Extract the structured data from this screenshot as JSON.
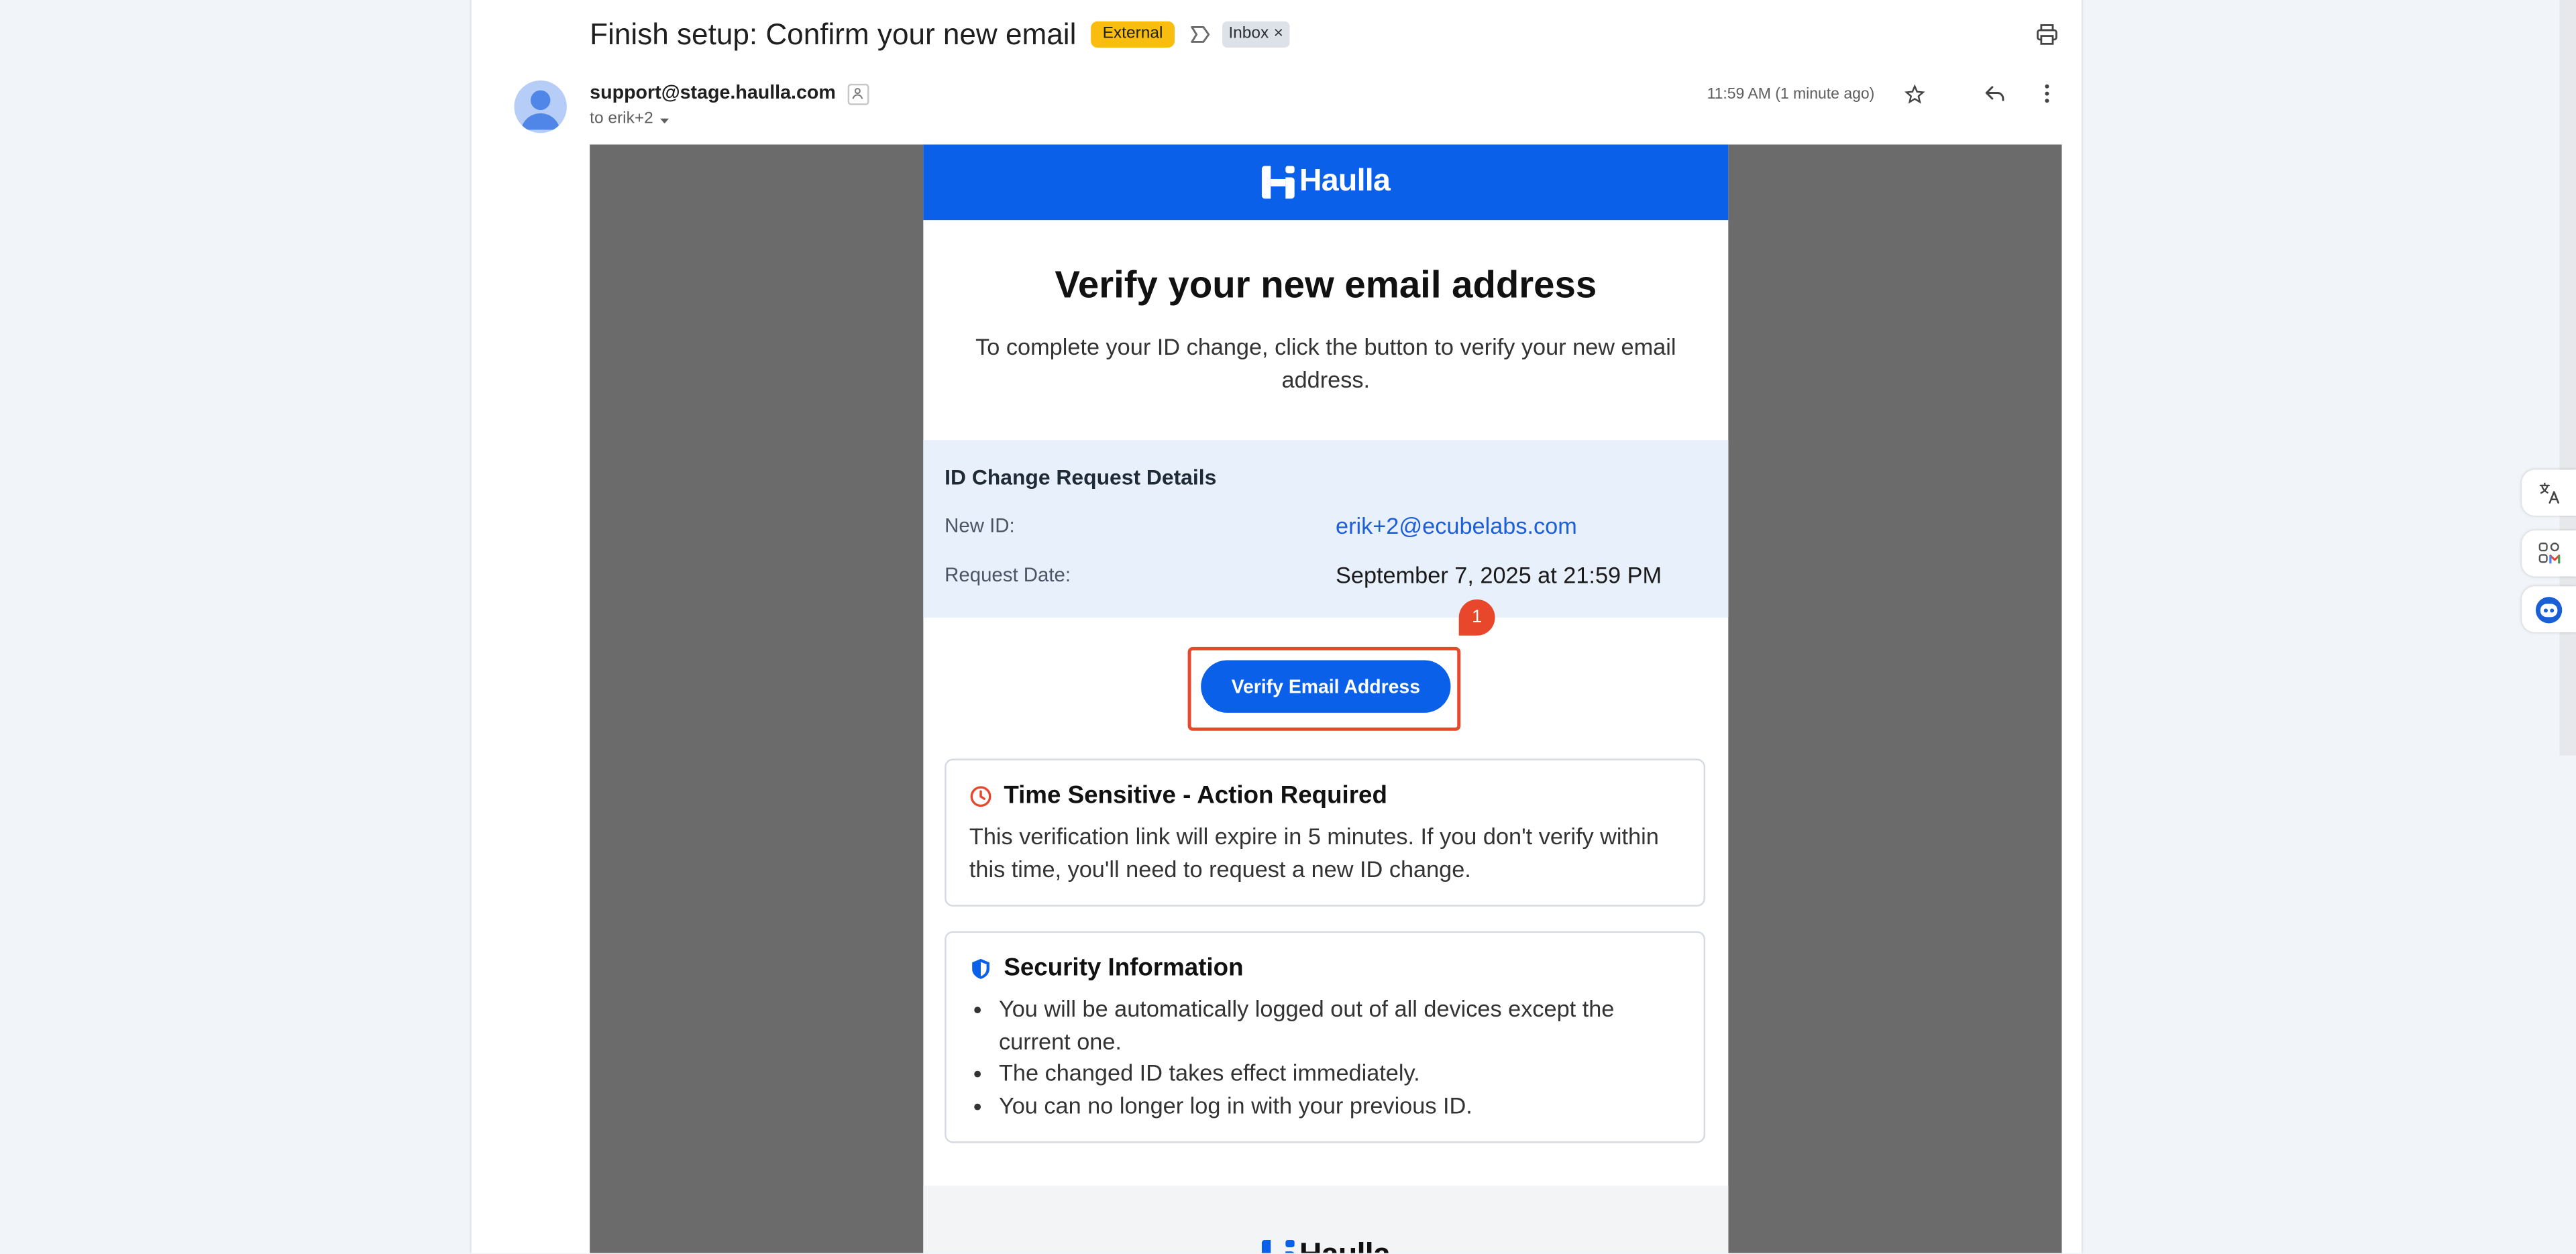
{
  "colors": {
    "brand_blue": "#0a60e9",
    "highlight_red": "#e8472b",
    "external_badge": "#f9bd0f",
    "details_background": "#e8f0fc",
    "email_canvas": "#6b6b6b"
  },
  "thread": {
    "subject": "Finish setup: Confirm your new email",
    "external_label": "External",
    "inbox_label": "Inbox",
    "inbox_remove": "×",
    "icons": {
      "important": "important-marker-icon",
      "print": "print-icon"
    }
  },
  "message": {
    "sender": "support@stage.haulla.com",
    "recipient": "to erik+2",
    "time": "11:59 AM (1 minute ago)",
    "icons": {
      "avatar": "avatar-icon",
      "sender_info": "sender-info-icon",
      "details": "chevron-down-icon",
      "star": "star-icon",
      "reply": "reply-icon",
      "more": "more-vert-icon"
    }
  },
  "email": {
    "brand": "Haulla",
    "heading": "Verify your new email address",
    "intro": "To complete your ID change, click the button to verify your new email address.",
    "details": {
      "title": "ID Change Request Details",
      "rows": [
        {
          "label": "New ID:",
          "value": "erik+2@ecubelabs.com"
        },
        {
          "label": "Request Date:",
          "value": "September 7, 2025 at 21:59 PM"
        }
      ]
    },
    "cta": {
      "label": "Verify Email Address",
      "marker": "1"
    },
    "time_sensitive": {
      "icon": "clock-icon",
      "title": "Time Sensitive - Action Required",
      "body": "This verification link will expire in 5 minutes. If you don't verify within this time, you'll need to request a new ID change."
    },
    "security": {
      "icon": "shield-icon",
      "title": "Security Information",
      "bullets": [
        "You will be automatically logged out of all devices except the current one.",
        "The changed ID takes effect immediately.",
        "You can no longer log in with your previous ID."
      ]
    },
    "footer_brand": "Haulla"
  },
  "side_panel": {
    "icons": [
      "translate-icon",
      "apps-icon",
      "assistant-icon"
    ]
  }
}
